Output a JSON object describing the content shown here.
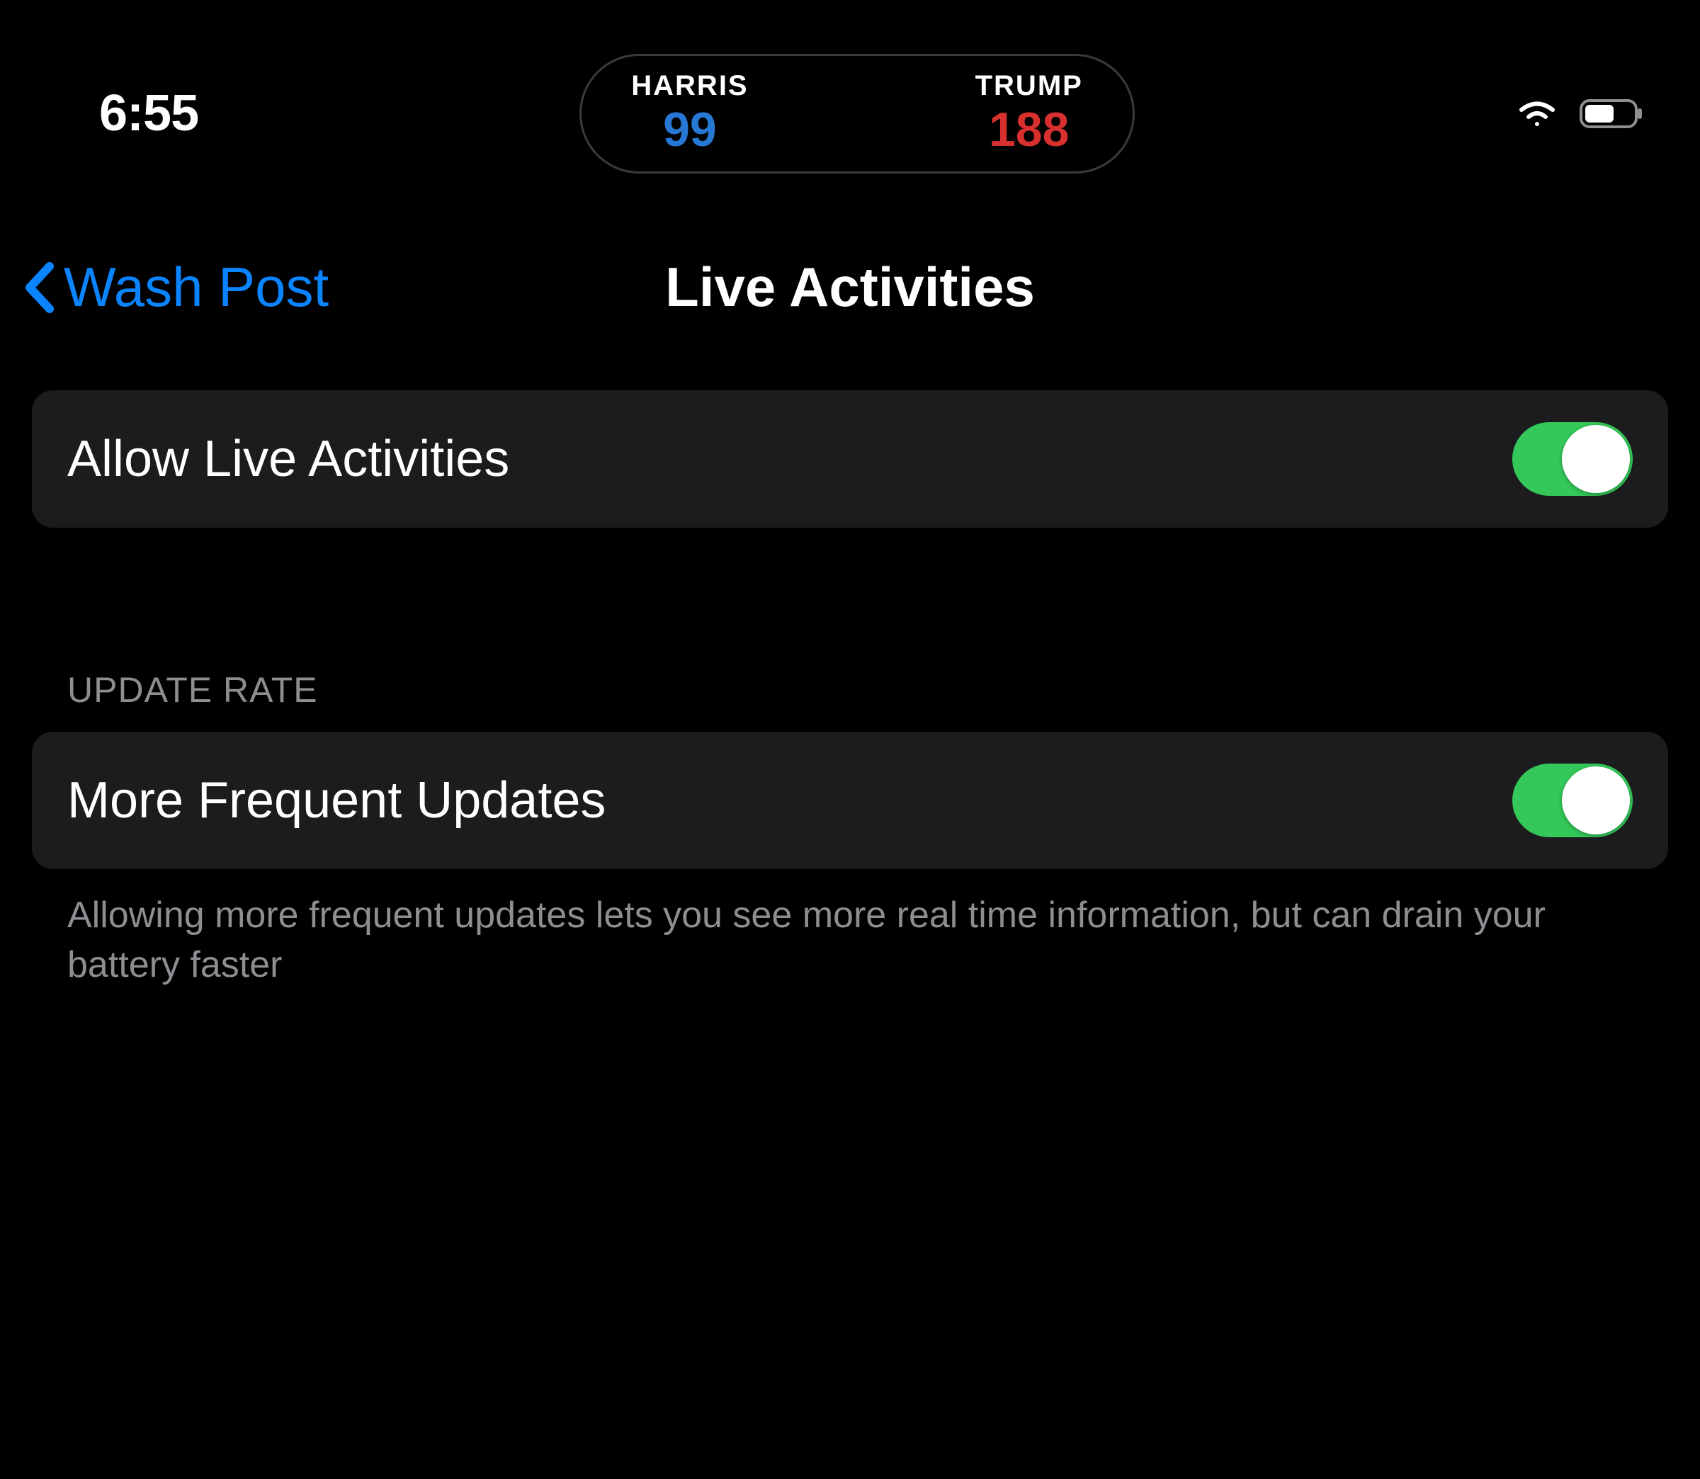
{
  "status_bar": {
    "time": "6:55",
    "dynamic_island": {
      "left": {
        "label": "HARRIS",
        "score": "99"
      },
      "right": {
        "label": "TRUMP",
        "score": "188"
      }
    }
  },
  "nav": {
    "back_label": "Wash Post",
    "title": "Live Activities"
  },
  "settings": {
    "allow_live_activities": {
      "label": "Allow Live Activities",
      "enabled": true
    },
    "update_rate": {
      "header": "UPDATE RATE",
      "more_frequent_updates": {
        "label": "More Frequent Updates",
        "enabled": true
      },
      "footer": "Allowing more frequent updates lets you see more real time information, but can drain your battery faster"
    }
  }
}
